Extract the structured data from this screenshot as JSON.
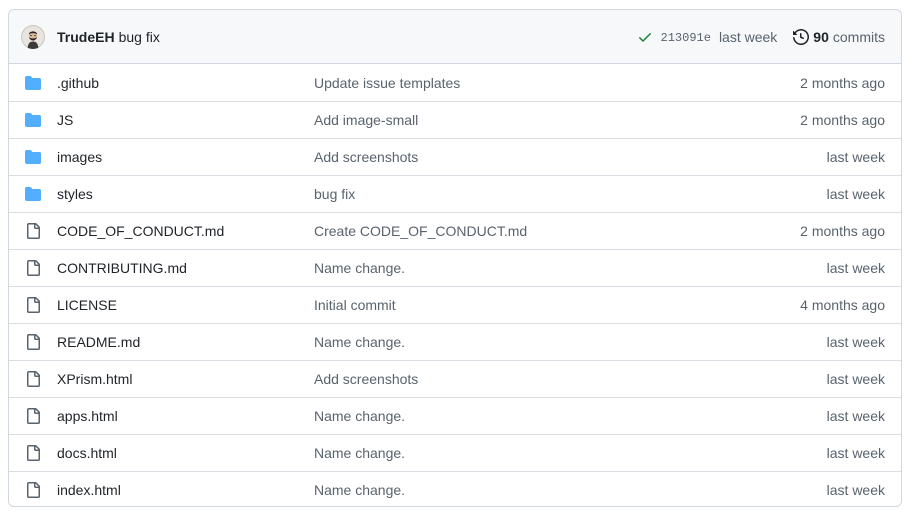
{
  "latest_commit": {
    "author": "TrudeEH",
    "message": "bug fix",
    "sha": "213091e",
    "time": "last week",
    "commits_count": "90",
    "commits_label": "commits"
  },
  "colors": {
    "folder": "#54aeff",
    "file": "#59636e",
    "check": "#1a7f37"
  },
  "files": [
    {
      "type": "folder",
      "name": ".github",
      "message": "Update issue templates",
      "age": "2 months ago"
    },
    {
      "type": "folder",
      "name": "JS",
      "message": "Add image-small",
      "age": "2 months ago"
    },
    {
      "type": "folder",
      "name": "images",
      "message": "Add screenshots",
      "age": "last week"
    },
    {
      "type": "folder",
      "name": "styles",
      "message": "bug fix",
      "age": "last week"
    },
    {
      "type": "file",
      "name": "CODE_OF_CONDUCT.md",
      "message": "Create CODE_OF_CONDUCT.md",
      "age": "2 months ago"
    },
    {
      "type": "file",
      "name": "CONTRIBUTING.md",
      "message": "Name change.",
      "age": "last week"
    },
    {
      "type": "file",
      "name": "LICENSE",
      "message": "Initial commit",
      "age": "4 months ago"
    },
    {
      "type": "file",
      "name": "README.md",
      "message": "Name change.",
      "age": "last week"
    },
    {
      "type": "file",
      "name": "XPrism.html",
      "message": "Add screenshots",
      "age": "last week"
    },
    {
      "type": "file",
      "name": "apps.html",
      "message": "Name change.",
      "age": "last week"
    },
    {
      "type": "file",
      "name": "docs.html",
      "message": "Name change.",
      "age": "last week"
    },
    {
      "type": "file",
      "name": "index.html",
      "message": "Name change.",
      "age": "last week"
    }
  ]
}
